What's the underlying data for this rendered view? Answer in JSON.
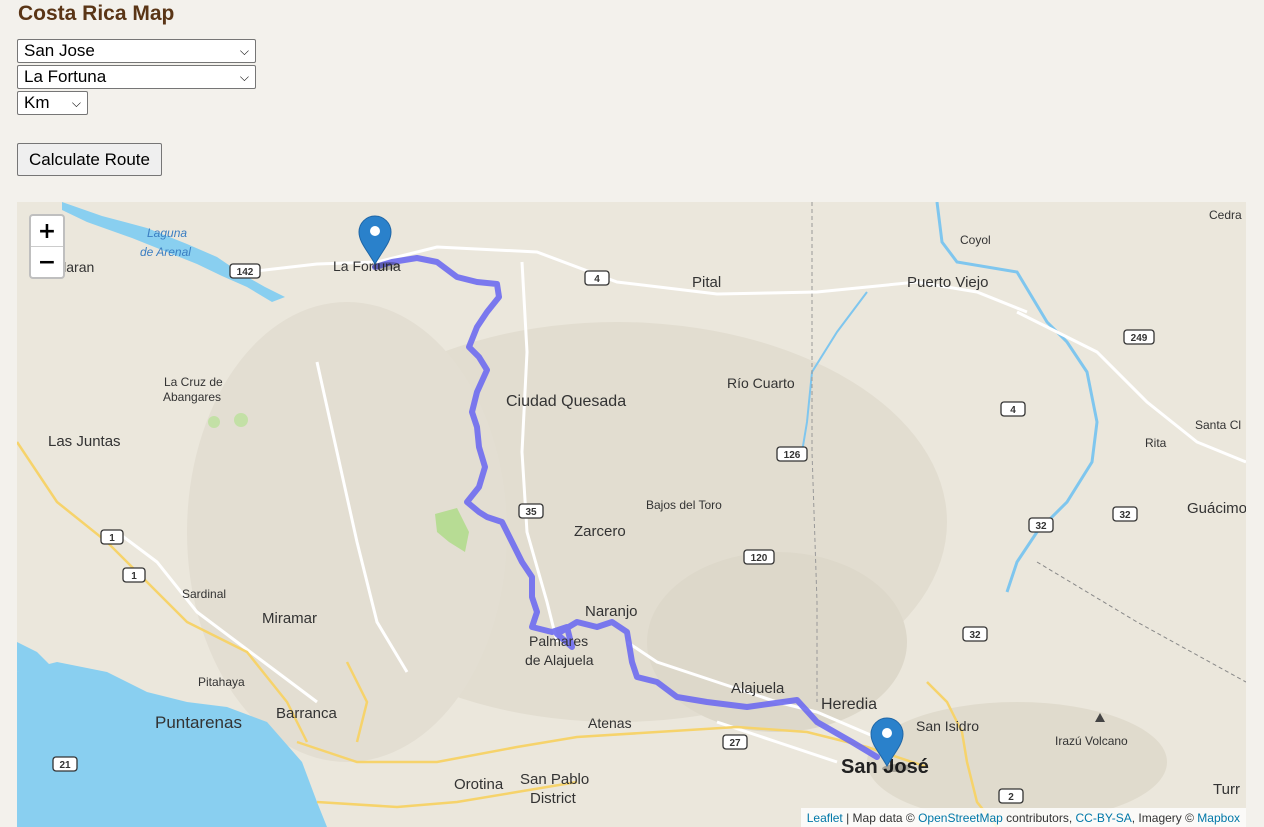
{
  "title": "Costa Rica Map",
  "controls": {
    "origin_value": "San Jose",
    "destination_value": "La Fortuna",
    "unit_value": "Km",
    "calculate_label": "Calculate Route"
  },
  "map": {
    "zoom_in": "+",
    "zoom_out": "−",
    "markers": [
      {
        "name": "La Fortuna",
        "color": "#2a81cb"
      },
      {
        "name": "San José",
        "color": "#2a81cb"
      }
    ],
    "route_color": "#6e6cf0",
    "water_color": "#89cff0",
    "places": [
      {
        "key": "la_fortuna",
        "label": "La Fortuna"
      },
      {
        "key": "laguna",
        "label": "Laguna"
      },
      {
        "key": "de_arenal",
        "label": "de Arenal"
      },
      {
        "key": "tilaran",
        "label": "Tilaran"
      },
      {
        "key": "pital",
        "label": "Pital"
      },
      {
        "key": "puerto_viejo",
        "label": "Puerto Viejo"
      },
      {
        "key": "coyol",
        "label": "Coyol"
      },
      {
        "key": "cedra",
        "label": "Cedra"
      },
      {
        "key": "la_cruz",
        "label": "La Cruz de"
      },
      {
        "key": "abangares",
        "label": "Abangares"
      },
      {
        "key": "rio_cuarto",
        "label": "Río Cuarto"
      },
      {
        "key": "ciudad_quesada",
        "label": "Ciudad Quesada"
      },
      {
        "key": "las_juntas",
        "label": "Las Juntas"
      },
      {
        "key": "santa_cl",
        "label": "Santa Cl"
      },
      {
        "key": "rita",
        "label": "Rita"
      },
      {
        "key": "bajos_del_toro",
        "label": "Bajos del Toro"
      },
      {
        "key": "zarcero",
        "label": "Zarcero"
      },
      {
        "key": "guacimo",
        "label": "Guácimo"
      },
      {
        "key": "sardinal",
        "label": "Sardinal"
      },
      {
        "key": "miramar",
        "label": "Miramar"
      },
      {
        "key": "naranjo",
        "label": "Naranjo"
      },
      {
        "key": "palmares",
        "label": "Palmares"
      },
      {
        "key": "de_alajuela",
        "label": "de Alajuela"
      },
      {
        "key": "pitahaya",
        "label": "Pitahaya"
      },
      {
        "key": "alajuela",
        "label": "Alajuela"
      },
      {
        "key": "heredia",
        "label": "Heredia"
      },
      {
        "key": "puntarenas",
        "label": "Puntarenas"
      },
      {
        "key": "barranca",
        "label": "Barranca"
      },
      {
        "key": "atenas",
        "label": "Atenas"
      },
      {
        "key": "san_isidro",
        "label": "San Isidro"
      },
      {
        "key": "irazu",
        "label": "Irazú Volcano"
      },
      {
        "key": "san_jose",
        "label": "San José"
      },
      {
        "key": "orotina",
        "label": "Orotina"
      },
      {
        "key": "san_pablo",
        "label": "San Pablo"
      },
      {
        "key": "district",
        "label": "District"
      },
      {
        "key": "turr",
        "label": "Turr"
      }
    ],
    "shields": [
      "142",
      "4",
      "249",
      "4",
      "126",
      "35",
      "120",
      "1",
      "1",
      "32",
      "32",
      "32",
      "27",
      "21",
      "2"
    ],
    "attribution": {
      "leaflet": "Leaflet",
      "sep1": " | Map data © ",
      "osm": "OpenStreetMap",
      "contrib": " contributors, ",
      "license": "CC-BY-SA",
      "imagery": ", Imagery © ",
      "mapbox": "Mapbox"
    }
  }
}
